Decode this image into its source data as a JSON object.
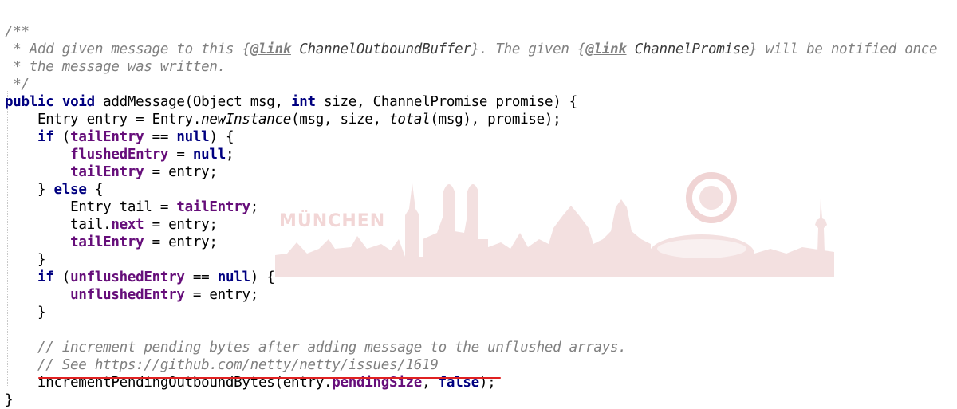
{
  "watermark": {
    "text": "MÜNCHEN",
    "color": "#f2dede",
    "crest_color": "#f0d4d4"
  },
  "editor": {
    "background": "#ffffff",
    "underline_color": "#e02121",
    "lines": [
      {
        "indent": "",
        "tokens": [
          {
            "t": "/**",
            "c": "doc"
          }
        ]
      },
      {
        "indent": "",
        "tokens": [
          {
            "t": " * Add given message to this {",
            "c": "doc"
          },
          {
            "t": "@link",
            "c": "tag"
          },
          {
            "t": " ChannelOutboundBuffer",
            "c": "dref"
          },
          {
            "t": "}. The given {",
            "c": "doc"
          },
          {
            "t": "@link",
            "c": "tag"
          },
          {
            "t": " ChannelPromise",
            "c": "dref"
          },
          {
            "t": "} will be notified once",
            "c": "doc"
          }
        ]
      },
      {
        "indent": "",
        "tokens": [
          {
            "t": " * the message was written.",
            "c": "doc"
          }
        ]
      },
      {
        "indent": "",
        "tokens": [
          {
            "t": " */",
            "c": "doc"
          }
        ]
      },
      {
        "indent": "",
        "tokens": [
          {
            "t": "public",
            "c": "kw"
          },
          {
            "t": " "
          },
          {
            "t": "void",
            "c": "kw"
          },
          {
            "t": " addMessage(Object msg, "
          },
          {
            "t": "int",
            "c": "kw"
          },
          {
            "t": " size, ChannelPromise promise) {"
          }
        ]
      },
      {
        "indent": "    ",
        "tokens": [
          {
            "t": "Entry entry = Entry."
          },
          {
            "t": "newInstance",
            "c": "it"
          },
          {
            "t": "(msg, size, "
          },
          {
            "t": "total",
            "c": "it"
          },
          {
            "t": "(msg), promise);"
          }
        ]
      },
      {
        "indent": "    ",
        "tokens": [
          {
            "t": "if",
            "c": "kw"
          },
          {
            "t": " ("
          },
          {
            "t": "tailEntry",
            "c": "fld"
          },
          {
            "t": " == "
          },
          {
            "t": "null",
            "c": "kw"
          },
          {
            "t": ") {"
          }
        ]
      },
      {
        "indent": "        ",
        "tokens": [
          {
            "t": "flushedEntry",
            "c": "fld"
          },
          {
            "t": " = "
          },
          {
            "t": "null",
            "c": "kw"
          },
          {
            "t": ";"
          }
        ]
      },
      {
        "indent": "        ",
        "tokens": [
          {
            "t": "tailEntry",
            "c": "fld"
          },
          {
            "t": " = entry;"
          }
        ]
      },
      {
        "indent": "    ",
        "tokens": [
          {
            "t": "} "
          },
          {
            "t": "else",
            "c": "kw"
          },
          {
            "t": " {"
          }
        ]
      },
      {
        "indent": "        ",
        "tokens": [
          {
            "t": "Entry tail = "
          },
          {
            "t": "tailEntry",
            "c": "fld"
          },
          {
            "t": ";"
          }
        ]
      },
      {
        "indent": "        ",
        "tokens": [
          {
            "t": "tail."
          },
          {
            "t": "next",
            "c": "fld"
          },
          {
            "t": " = entry;"
          }
        ]
      },
      {
        "indent": "        ",
        "tokens": [
          {
            "t": "tailEntry",
            "c": "fld"
          },
          {
            "t": " = entry;"
          }
        ]
      },
      {
        "indent": "    ",
        "tokens": [
          {
            "t": "}"
          }
        ]
      },
      {
        "indent": "    ",
        "tokens": [
          {
            "t": "if",
            "c": "kw"
          },
          {
            "t": " ("
          },
          {
            "t": "unflushedEntry",
            "c": "fld"
          },
          {
            "t": " == "
          },
          {
            "t": "null",
            "c": "kw"
          },
          {
            "t": ") {"
          }
        ]
      },
      {
        "indent": "        ",
        "tokens": [
          {
            "t": "unflushedEntry",
            "c": "fld"
          },
          {
            "t": " = entry;"
          }
        ]
      },
      {
        "indent": "    ",
        "tokens": [
          {
            "t": "}"
          }
        ]
      },
      {
        "indent": "",
        "tokens": []
      },
      {
        "indent": "    ",
        "tokens": [
          {
            "t": "// increment pending bytes after adding message to the unflushed arrays.",
            "c": "cm"
          }
        ]
      },
      {
        "indent": "    ",
        "tokens": [
          {
            "t": "// See https://github.com/netty/netty/issues/1619",
            "c": "cm"
          }
        ]
      },
      {
        "indent": "    ",
        "tokens": [
          {
            "t": "incrementPendingOutboundBytes(entry."
          },
          {
            "t": "pendingSize",
            "c": "fld"
          },
          {
            "t": ", "
          },
          {
            "t": "false",
            "c": "kw"
          },
          {
            "t": ");"
          }
        ]
      },
      {
        "indent": "",
        "tokens": [
          {
            "t": "}"
          }
        ]
      }
    ]
  }
}
